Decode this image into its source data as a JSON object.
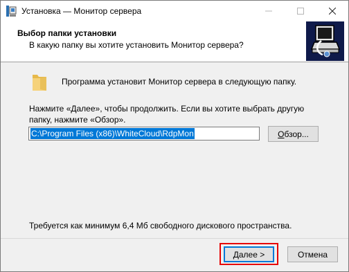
{
  "window": {
    "title": "Установка — Монитор сервера",
    "icon": "installer-app-icon"
  },
  "header": {
    "title": "Выбор папки установки",
    "subtitle": "В какую папку вы хотите установить Монитор сервера?",
    "logo": "computer-install-logo"
  },
  "body": {
    "intro": "Программа установит Монитор сервера в следующую папку.",
    "instruction": "Нажмите «Далее», чтобы продолжить. Если вы хотите выбрать другую папку, нажмите «Обзор».",
    "path_value": "C:\\Program Files (x86)\\WhiteCloud\\RdpMon",
    "browse_accel": "О",
    "browse_rest": "бзор...",
    "disk_space": "Требуется как минимум 6,4 Мб свободного дискового пространства."
  },
  "footer": {
    "next_accel": "Д",
    "next_rest": "алее >",
    "cancel_label": "Отмена"
  },
  "colors": {
    "selection": "#0078d7",
    "highlight": "#e60000",
    "window_bg": "#f0f0f0"
  }
}
